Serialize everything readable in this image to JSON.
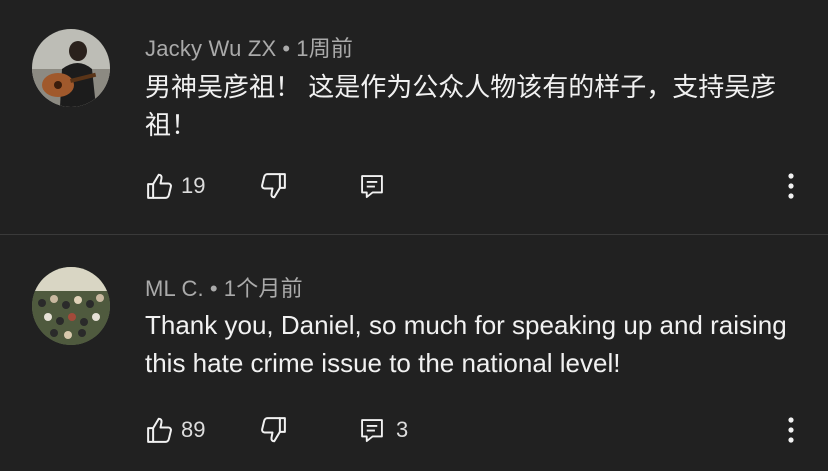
{
  "comments": [
    {
      "author": "Jacky Wu ZX",
      "separator": "•",
      "time": "1周前",
      "text": "男神吴彦祖！ 这是作为公众人物该有的样子，支持吴彦祖！",
      "likes": "19",
      "replies": "",
      "avatar_icon": "person-with-guitar-photo"
    },
    {
      "author": "ML C.",
      "separator": "•",
      "time": "1个月前",
      "text": "Thank you, Daniel, so much for speaking up and raising this hate crime issue to the national level!",
      "likes": "89",
      "replies": "3",
      "avatar_icon": "crowd-photo"
    }
  ],
  "icons": {
    "like": "thumbs-up-icon",
    "dislike": "thumbs-down-icon",
    "reply": "reply-icon",
    "more": "more-vert-icon"
  },
  "colors": {
    "background": "#212121",
    "text": "#f1f1f1",
    "meta": "#aaaaaa"
  }
}
